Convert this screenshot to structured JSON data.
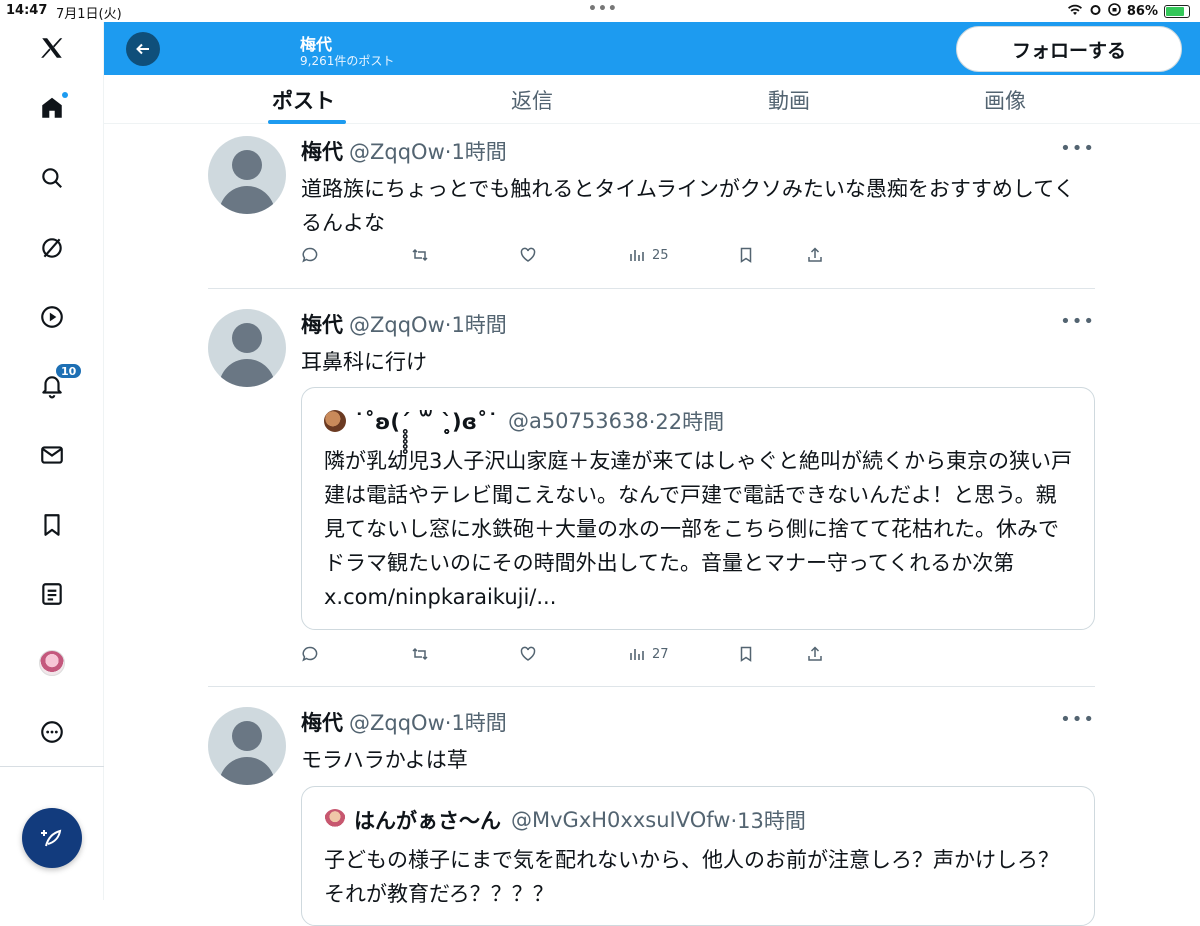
{
  "status_bar": {
    "time": "14:47",
    "date": "7月1日(火)",
    "battery": "86%"
  },
  "header": {
    "name": "梅代",
    "post_count": "9,261件のポスト",
    "follow_label": "フォローする"
  },
  "tabs": [
    {
      "label": "ポスト"
    },
    {
      "label": "返信"
    },
    {
      "label": "動画"
    },
    {
      "label": "画像"
    }
  ],
  "rail": {
    "notification_count": "10"
  },
  "posts": [
    {
      "name": "梅代",
      "handle": "@ZqqOw",
      "time": "·1時間",
      "text": "道路族にちょっとでも触れるとタイムラインがクソみたいな愚痴をおすすめしてくるんよな",
      "views": "25"
    },
    {
      "name": "梅代",
      "handle": "@ZqqOw",
      "time": "·1時間",
      "text": "耳鼻科に行け",
      "views": "27",
      "quote": {
        "name": "˙˚ʚ(ˊ̥̥̥̥̥ ꒳ ˋ̥̥̥̥̥)ɞ˚˙",
        "handle": "@a50753638",
        "time": "·22時間",
        "text": "隣が乳幼児3人子沢山家庭＋友達が来てはしゃぐと絶叫が続くから東京の狭い戸建は電話やテレビ聞こえない。なんで戸建で電話できないんだよ！と思う。親見てないし窓に水鉄砲＋大量の水の一部をこちら側に捨てて花枯れた。休みでドラマ観たいのにその時間外出してた。音量とマナー守ってくれるか次第 x.com/ninpkaraikuji/..."
      }
    },
    {
      "name": "梅代",
      "handle": "@ZqqOw",
      "time": "·1時間",
      "text": "モラハラかよは草",
      "quote": {
        "name": "はんがぁさ〜ん",
        "handle": "@MvGxH0xxsuIVOfw",
        "time": "·13時間",
        "text": "子どもの様子にまで気を配れないから、他人のお前が注意しろ？声かけしろ？それが教育だろ？？？？"
      }
    }
  ],
  "colors": {
    "accent": "#1d9bf0",
    "header_bg": "#1d9bf0",
    "compose_bg": "#123b7d"
  }
}
